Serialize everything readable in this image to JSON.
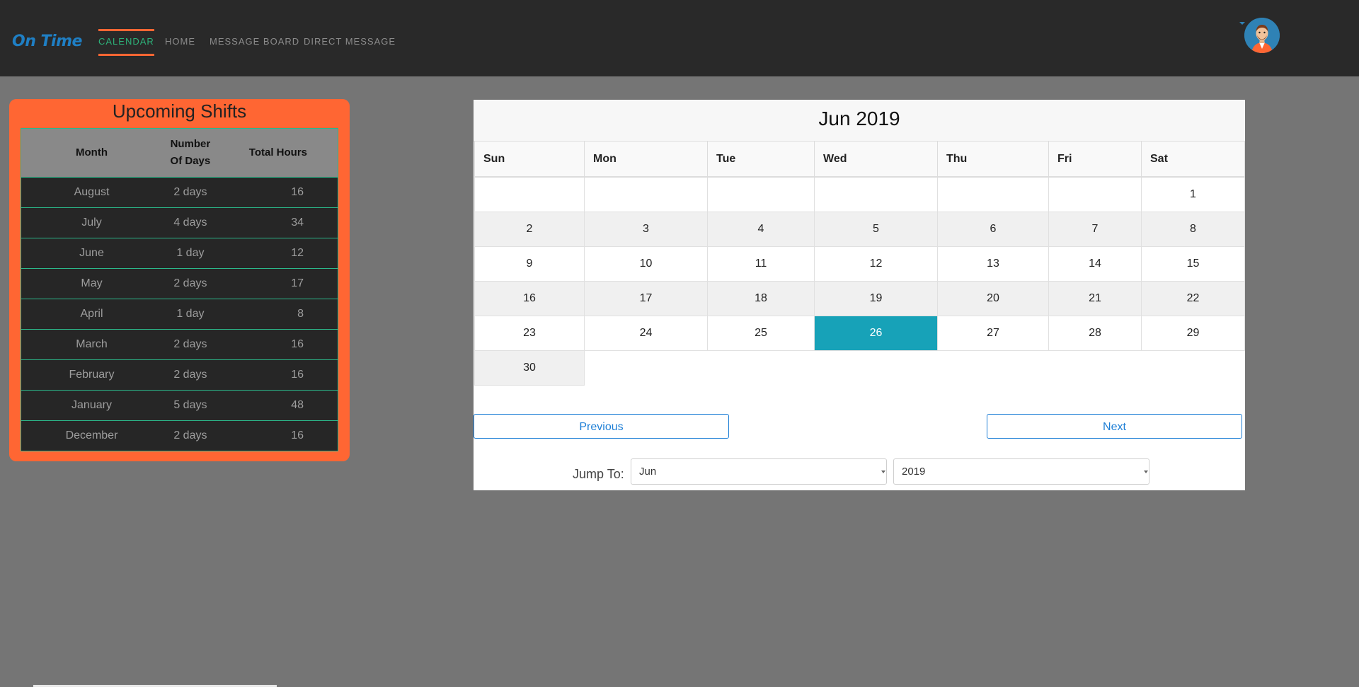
{
  "nav": {
    "brand": "On Time",
    "items": [
      {
        "label": "CALENDAR",
        "active": true
      },
      {
        "label": "HOME",
        "active": false
      },
      {
        "label": "MESSAGE BOARD",
        "active": false
      },
      {
        "label": "DIRECT MESSAGE",
        "active": false
      }
    ],
    "avatar_icon": "user-avatar-icon"
  },
  "shifts": {
    "title": "Upcoming Shifts",
    "headers": {
      "month": "Month",
      "days_line1": "Number",
      "days_line2": "Of Days",
      "hours": "Total Hours"
    },
    "rows": [
      {
        "month": "August",
        "days": "2 days",
        "hours": "16"
      },
      {
        "month": "July",
        "days": "4 days",
        "hours": "34"
      },
      {
        "month": "June",
        "days": "1 day",
        "hours": "12"
      },
      {
        "month": "May",
        "days": "2 days",
        "hours": "17"
      },
      {
        "month": "April",
        "days": "1 day",
        "hours": "8"
      },
      {
        "month": "March",
        "days": "2 days",
        "hours": "16"
      },
      {
        "month": "February",
        "days": "2 days",
        "hours": "16"
      },
      {
        "month": "January",
        "days": "5 days",
        "hours": "48"
      },
      {
        "month": "December",
        "days": "2 days",
        "hours": "16"
      }
    ]
  },
  "calendar": {
    "title": "Jun 2019",
    "weekdays": [
      "Sun",
      "Mon",
      "Tue",
      "Wed",
      "Thu",
      "Fri",
      "Sat"
    ],
    "weeks": [
      [
        "",
        "",
        "",
        "",
        "",
        "",
        "1"
      ],
      [
        "2",
        "3",
        "4",
        "5",
        "6",
        "7",
        "8"
      ],
      [
        "9",
        "10",
        "11",
        "12",
        "13",
        "14",
        "15"
      ],
      [
        "16",
        "17",
        "18",
        "19",
        "20",
        "21",
        "22"
      ],
      [
        "23",
        "24",
        "25",
        "26",
        "27",
        "28",
        "29"
      ],
      [
        "30"
      ]
    ],
    "today": "26",
    "previous_label": "Previous",
    "next_label": "Next",
    "jump_label": "Jump To:",
    "month_select": "Jun",
    "year_select": "2019"
  },
  "colors": {
    "accent_orange": "#ff6633",
    "active_nav_green": "#2db37a",
    "today_teal": "#17a2b8",
    "button_blue": "#1e7fd6"
  }
}
